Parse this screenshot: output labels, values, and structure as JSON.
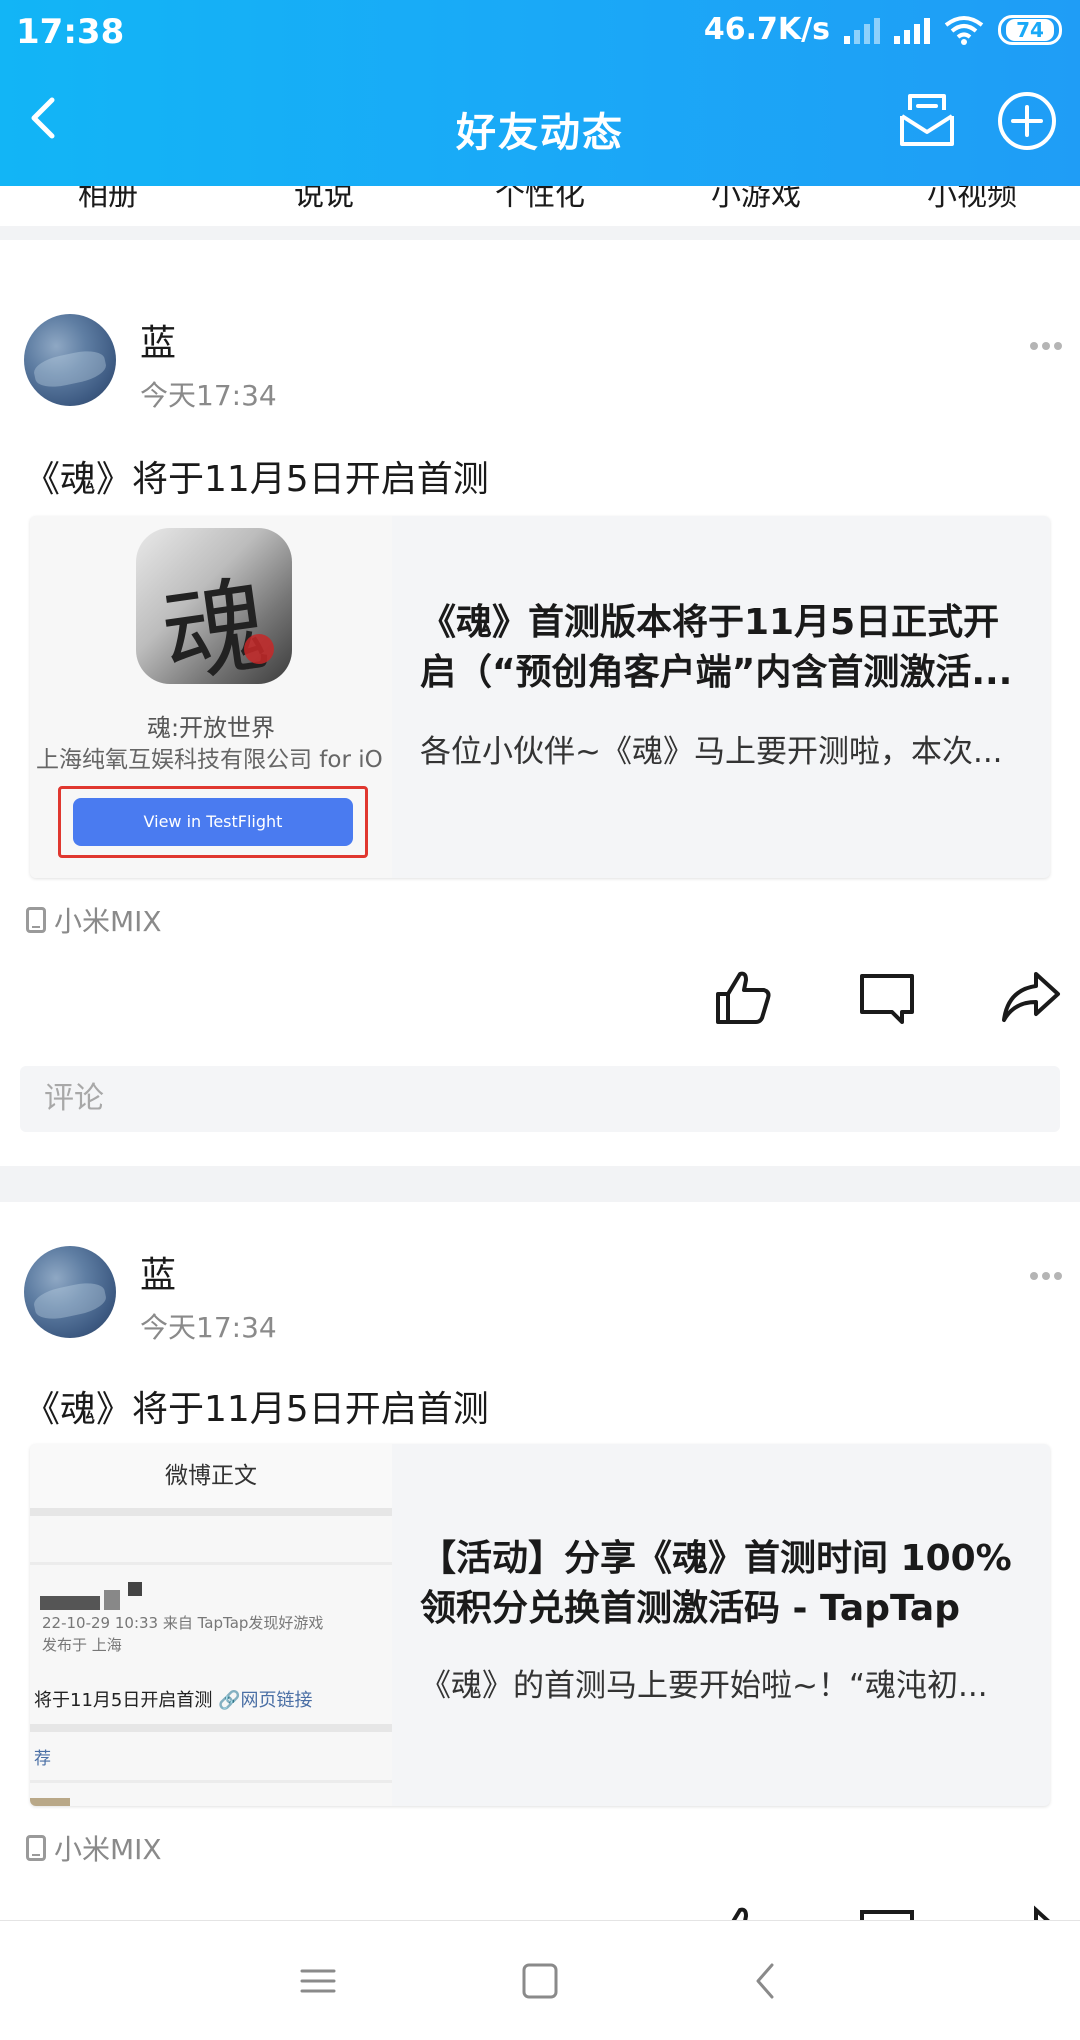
{
  "status_bar": {
    "time": "17:38",
    "net_speed": "46.7K/s",
    "battery": "74"
  },
  "header": {
    "title": "好友动态",
    "icons": [
      "back-icon",
      "mailbox-icon",
      "plus-circle-icon"
    ]
  },
  "tabs": [
    "相册",
    "说说",
    "个性化",
    "小游戏",
    "小视频"
  ],
  "posts": [
    {
      "user": "蓝",
      "time": "今天17:34",
      "text": "《魂》将于11月5日开启首测",
      "card": {
        "title": "《魂》首测版本将于11月5日正式开启（“预创角客户端”内含首测激活...",
        "desc": "各位小伙伴~《魂》马上要开测啦，本次...",
        "thumb": {
          "app_glyph": "魂",
          "app_name": "魂:开放世界",
          "company": "上海纯氧互娱科技有限公司 for iO",
          "button": "View in TestFlight"
        }
      },
      "device": "小米MIX",
      "comment_placeholder": "评论"
    },
    {
      "user": "蓝",
      "time": "今天17:34",
      "text": "《魂》将于11月5日开启首测",
      "card": {
        "title": "【活动】分享《魂》首测时间 100%领积分兑换首测激活码 - TapTap",
        "desc": "《魂》的首测马上要开始啦~！“魂沌初...",
        "thumb": {
          "header": "微博正文",
          "meta_line1": "22-10-29 10:33  来自 TapTap发现好游戏",
          "meta_line2": "发布于 上海",
          "text": "将于11月5日开启首测",
          "link": "🔗网页链接",
          "footer": "荐"
        }
      },
      "device": "小米MIX"
    }
  ],
  "colors": {
    "header_gradient_start": "#12b5f6",
    "header_gradient_end": "#1f9df6",
    "testflight_blue": "#4a7bf0",
    "highlight_red": "#e0372f"
  }
}
